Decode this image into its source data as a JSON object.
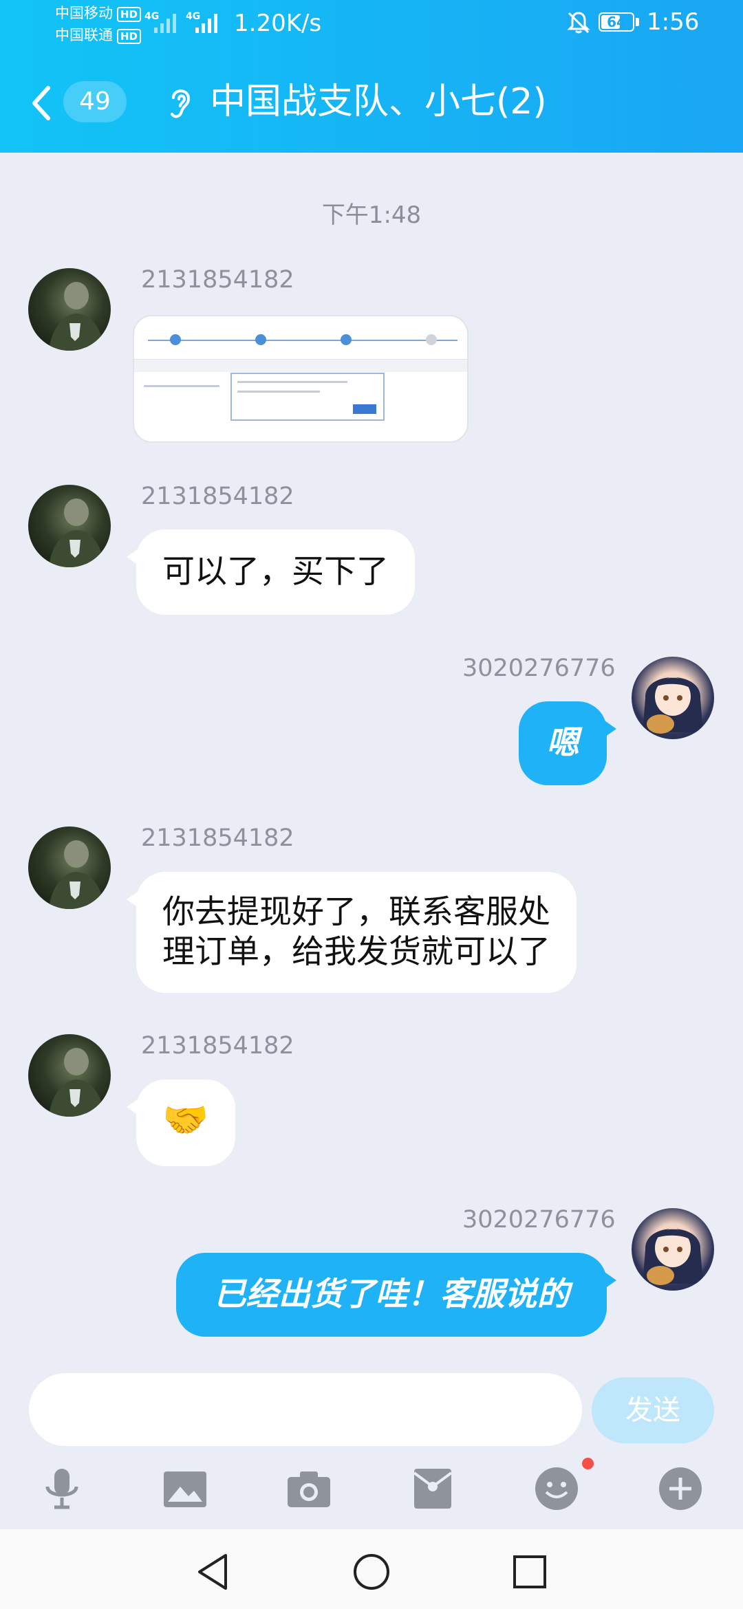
{
  "status_bar": {
    "carrier1": "中国移动",
    "carrier2": "中国联通",
    "hd": "HD",
    "network": "4G",
    "net_speed": "1.20K/s",
    "battery": "64",
    "time": "1:56"
  },
  "header": {
    "unread_count": "49",
    "title": "中国战支队、小七(2)"
  },
  "chat": {
    "timestamp": "下午1:48",
    "messages": [
      {
        "sender": "2131854182",
        "direction": "in",
        "type": "image"
      },
      {
        "sender": "2131854182",
        "direction": "in",
        "text": "可以了，买下了"
      },
      {
        "sender": "3020276776",
        "direction": "out",
        "text": "嗯"
      },
      {
        "sender": "2131854182",
        "direction": "in",
        "text_lines": [
          "你去提现好了，联系客服处",
          "理订单，给我发货就可以了"
        ]
      },
      {
        "sender": "2131854182",
        "direction": "in",
        "text": "🤝"
      },
      {
        "sender": "3020276776",
        "direction": "out",
        "text": "已经出货了哇！客服说的"
      }
    ]
  },
  "composer": {
    "input_value": "",
    "send_label": "发送"
  },
  "toolbar": {
    "icons": [
      "microphone-icon",
      "image-icon",
      "camera-icon",
      "red-packet-icon",
      "emoji-icon",
      "plus-icon"
    ],
    "emoji_has_badge": true
  },
  "system_nav": {
    "icons": [
      "back-triangle-icon",
      "home-circle-icon",
      "recent-square-icon"
    ]
  },
  "colors": {
    "header_gradient_start": "#12c4f7",
    "header_gradient_end": "#1aa6f3",
    "outgoing_bubble": "#1fb2f6",
    "background": "#eaedf5",
    "send_button": "#bfe7fb"
  }
}
